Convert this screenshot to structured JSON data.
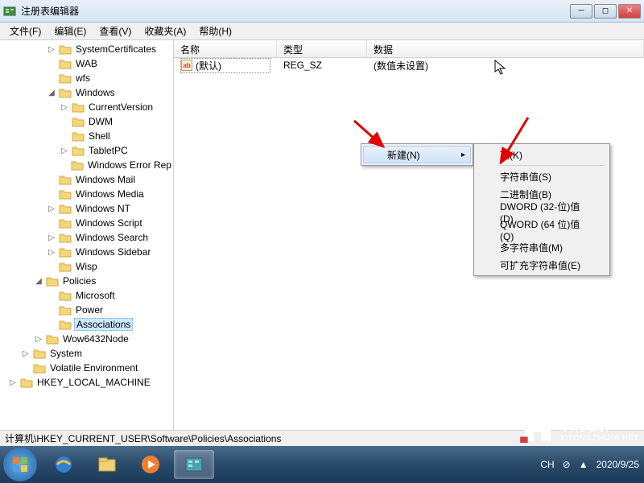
{
  "window": {
    "title": "注册表编辑器"
  },
  "menubar": {
    "file": "文件(F)",
    "edit": "编辑(E)",
    "view": "查看(V)",
    "favorites": "收藏夹(A)",
    "help": "帮助(H)"
  },
  "tree": {
    "items": [
      {
        "depth": 2,
        "expander": "▷",
        "label": "SystemCertificates"
      },
      {
        "depth": 2,
        "expander": "",
        "label": "WAB"
      },
      {
        "depth": 2,
        "expander": "",
        "label": "wfs"
      },
      {
        "depth": 2,
        "expander": "◢",
        "label": "Windows"
      },
      {
        "depth": 3,
        "expander": "▷",
        "label": "CurrentVersion"
      },
      {
        "depth": 3,
        "expander": "",
        "label": "DWM"
      },
      {
        "depth": 3,
        "expander": "",
        "label": "Shell"
      },
      {
        "depth": 3,
        "expander": "▷",
        "label": "TabletPC"
      },
      {
        "depth": 3,
        "expander": "",
        "label": "Windows Error Rep"
      },
      {
        "depth": 2,
        "expander": "",
        "label": "Windows Mail"
      },
      {
        "depth": 2,
        "expander": "",
        "label": "Windows Media"
      },
      {
        "depth": 2,
        "expander": "▷",
        "label": "Windows NT"
      },
      {
        "depth": 2,
        "expander": "",
        "label": "Windows Script"
      },
      {
        "depth": 2,
        "expander": "▷",
        "label": "Windows Search"
      },
      {
        "depth": 2,
        "expander": "▷",
        "label": "Windows Sidebar"
      },
      {
        "depth": 2,
        "expander": "",
        "label": "Wisp"
      },
      {
        "depth": 1,
        "expander": "◢",
        "label": "Policies"
      },
      {
        "depth": 2,
        "expander": "",
        "label": "Microsoft"
      },
      {
        "depth": 2,
        "expander": "",
        "label": "Power"
      },
      {
        "depth": 2,
        "expander": "",
        "label": "Associations",
        "selected": true
      },
      {
        "depth": 1,
        "expander": "▷",
        "label": "Wow6432Node"
      },
      {
        "depth": 0,
        "expander": "▷",
        "label": "System"
      },
      {
        "depth": 0,
        "expander": "",
        "label": "Volatile Environment"
      },
      {
        "depth": -1,
        "expander": "▷",
        "label": "HKEY_LOCAL_MACHINE"
      }
    ]
  },
  "list": {
    "headers": {
      "name": "名称",
      "type": "类型",
      "data": "数据"
    },
    "rows": [
      {
        "name": "(默认)",
        "type": "REG_SZ",
        "data": "(数值未设置)"
      }
    ]
  },
  "context_menu": {
    "new_label": "新建(N)",
    "submenu": {
      "key": "项(K)",
      "string": "字符串值(S)",
      "binary": "二进制值(B)",
      "dword": "DWORD (32-位)值(D)",
      "qword": "QWORD (64 位)值(Q)",
      "multi": "多字符串值(M)",
      "expand": "可扩充字符串值(E)"
    }
  },
  "statusbar": {
    "path": "计算机\\HKEY_CURRENT_USER\\Software\\Policies\\Associations"
  },
  "taskbar": {
    "ime": "CH",
    "date": "2020/9/25"
  },
  "watermark": {
    "name": "系统之家",
    "sub": "XITONGZHIJIA.NET"
  }
}
